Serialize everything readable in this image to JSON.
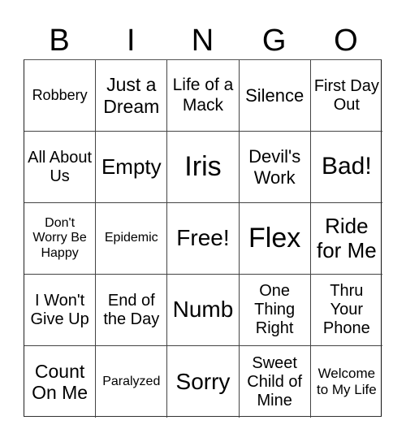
{
  "card": {
    "header": [
      "B",
      "I",
      "N",
      "G",
      "O"
    ],
    "rows": [
      [
        "Robbery",
        "Just a Dream",
        "Life of a Mack",
        "Silence",
        "First Day Out"
      ],
      [
        "All About Us",
        "Empty",
        "Iris",
        "Devil's Work",
        "Bad!"
      ],
      [
        "Don't Worry Be Happy",
        "Epidemic",
        "Free!",
        "Flex",
        "Ride for Me"
      ],
      [
        "I Won't Give Up",
        "End of the Day",
        "Numb",
        "One Thing Right",
        "Thru Your Phone"
      ],
      [
        "Count On Me",
        "Paralyzed",
        "Sorry",
        "Sweet Child of Mine",
        "Welcome to My Life"
      ]
    ],
    "free_space": "Free!"
  }
}
